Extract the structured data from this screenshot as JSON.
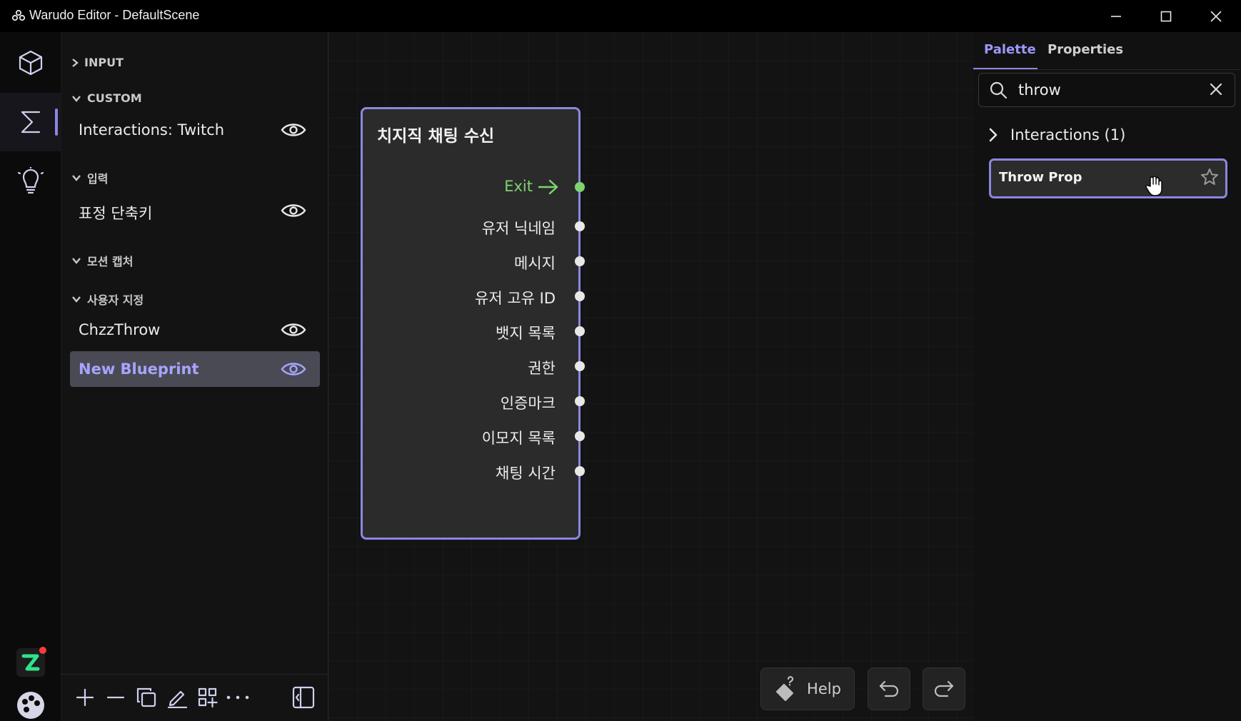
{
  "window": {
    "title": "Warudo Editor - DefaultScene"
  },
  "rail": {
    "items": [
      {
        "name": "scene",
        "icon": "cube-icon"
      },
      {
        "name": "blueprints",
        "icon": "sigma-icon",
        "active": true
      },
      {
        "name": "tips",
        "icon": "lightbulb-icon"
      }
    ],
    "bottom": [
      {
        "name": "zoom-app",
        "icon": "z-logo-icon",
        "notification": true
      },
      {
        "name": "community",
        "icon": "palette-icon"
      }
    ]
  },
  "sidebar": {
    "sections": [
      {
        "label": "INPUT",
        "expanded": false
      },
      {
        "label": "CUSTOM",
        "expanded": true
      },
      {
        "label": "입력",
        "expanded": true
      },
      {
        "label": "모션 캡처",
        "expanded": true
      },
      {
        "label": "사용자 지정",
        "expanded": true
      }
    ],
    "items": [
      {
        "label": "Interactions: Twitch"
      },
      {
        "label": "표정 단축키"
      },
      {
        "label": "ChzzThrow"
      },
      {
        "label": "New Blueprint",
        "selected": true
      }
    ]
  },
  "node": {
    "title": "치지직 채팅 수신",
    "exit_label": "Exit",
    "outputs": [
      "유저 닉네임",
      "메시지",
      "유저 고유 ID",
      "뱃지 목록",
      "권한",
      "인증마크",
      "이모지 목록",
      "채팅 시간"
    ]
  },
  "canvas": {
    "help_label": "Help"
  },
  "panel": {
    "tabs": [
      "Palette",
      "Properties"
    ],
    "active_tab": "Palette",
    "search_value": "throw",
    "category_label": "Interactions (1)",
    "result_label": "Throw Prop"
  },
  "colors": {
    "accent": "#8b87e0",
    "accent_text": "#a8a4ff",
    "flow_green": "#7dd56f"
  }
}
